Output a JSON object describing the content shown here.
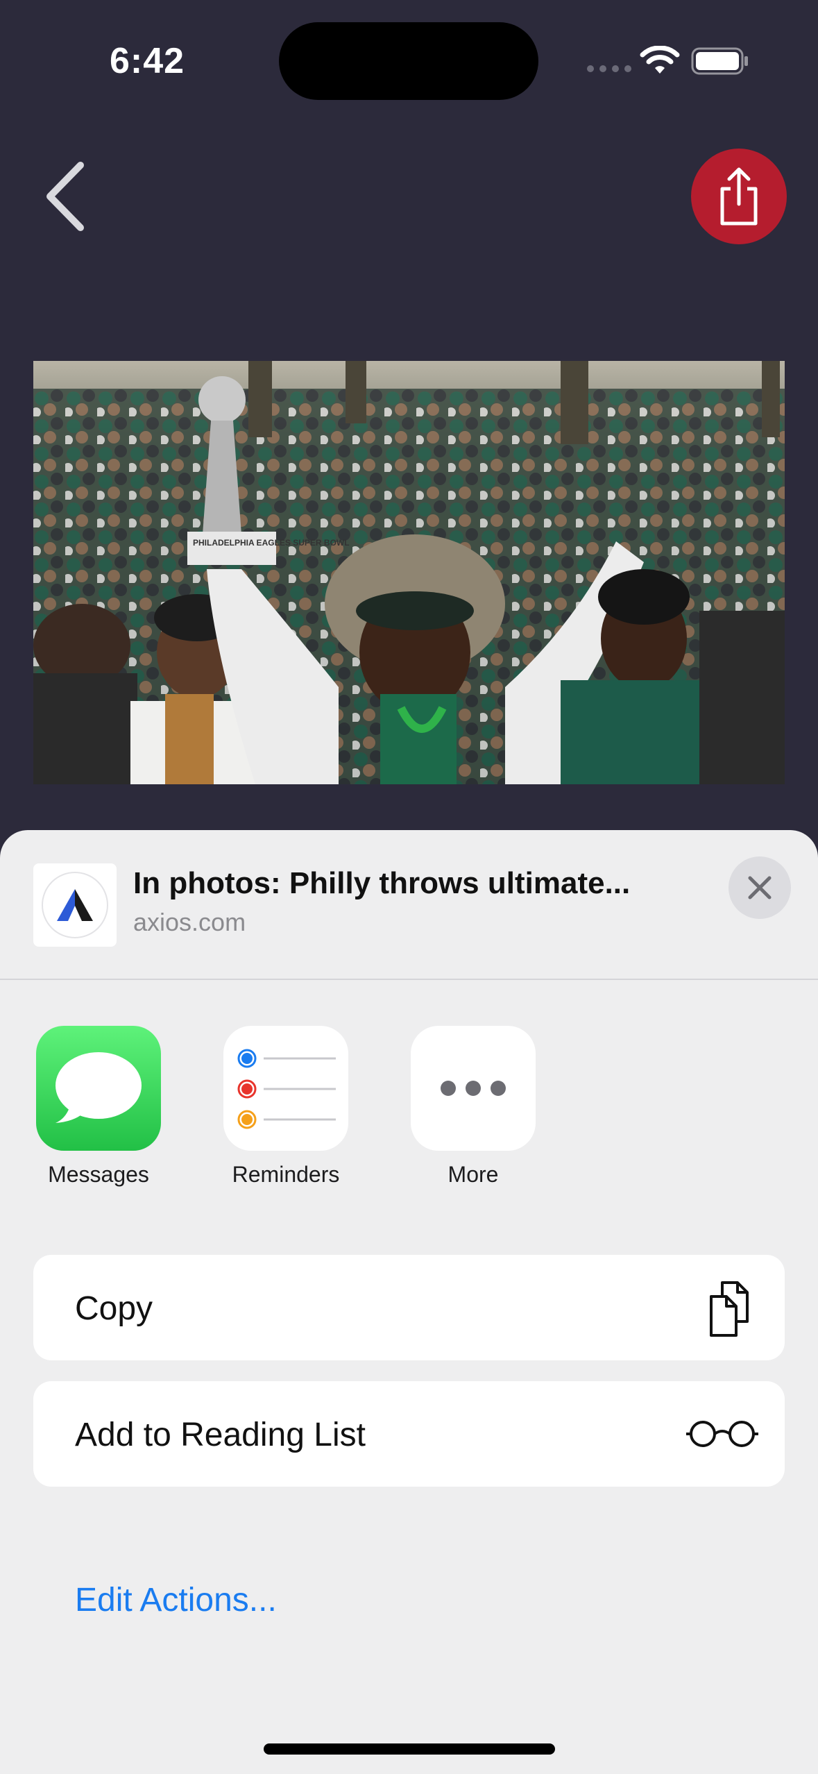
{
  "status_bar": {
    "time": "6:42"
  },
  "nav": {
    "back_icon": "chevron-left-icon",
    "share_icon": "share-icon",
    "share_color": "#b51d2e"
  },
  "photo": {
    "sign_text": "PHILADELPHIA EAGLES SUPER BOWL"
  },
  "share_sheet": {
    "title": "In photos: Philly throws ultimate...",
    "url": "axios.com",
    "apps": [
      {
        "label": "Messages",
        "icon": "messages-icon"
      },
      {
        "label": "Reminders",
        "icon": "reminders-icon"
      },
      {
        "label": "More",
        "icon": "more-icon"
      }
    ],
    "actions": [
      {
        "label": "Copy",
        "icon": "copy-icon"
      },
      {
        "label": "Add to Reading List",
        "icon": "glasses-icon"
      }
    ],
    "edit_actions": "Edit Actions..."
  },
  "colors": {
    "background": "#2c2a3b",
    "sheet": "#eeeeef",
    "link": "#1a7cf0",
    "messages_green": "#34c759"
  }
}
